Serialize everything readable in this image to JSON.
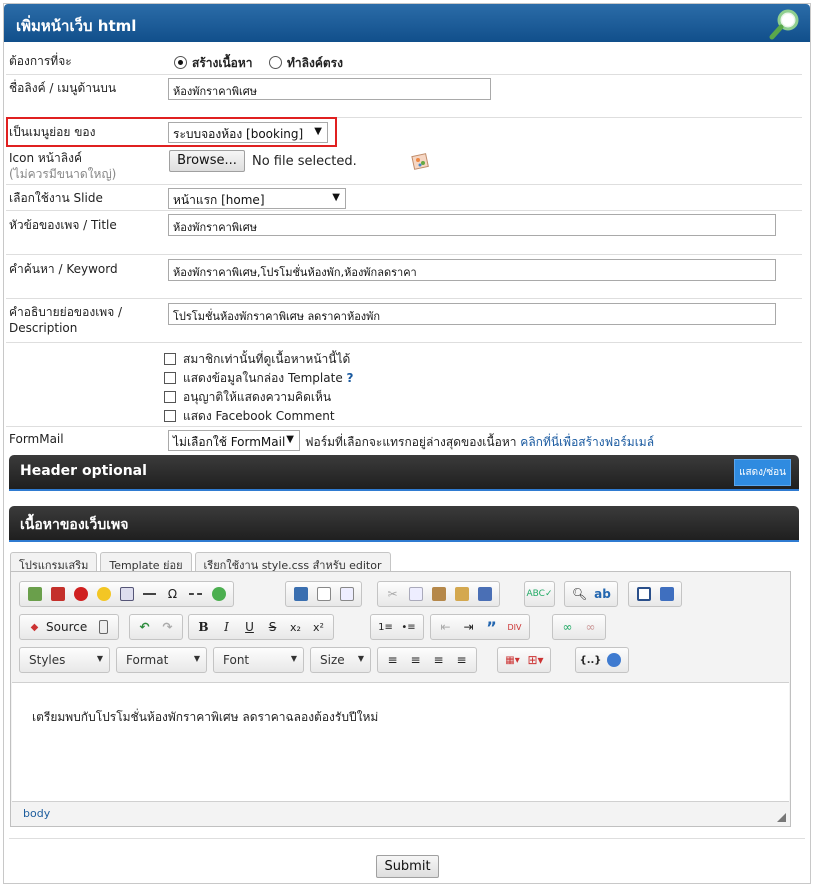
{
  "header": {
    "title": "เพิ่มหน้าเว็บ html",
    "icon": "magnifier-icon"
  },
  "form": {
    "want": {
      "label": "ต้องการที่จะ",
      "options": [
        "สร้างเนื้อหา",
        "ทำลิงค์ตรง"
      ],
      "selected": "สร้างเนื้อหา"
    },
    "linkname": {
      "label": "ชื่อลิงค์ / เมนูด้านบน",
      "value": "ห้องพักราคาพิเศษ"
    },
    "submenu": {
      "label": "เป็นเมนูย่อย ของ",
      "value": "ระบบจองห้อง [booking]"
    },
    "icon": {
      "label": "Icon หน้าลิงค์",
      "hint": "(ไม่ควรมีขนาดใหญ่)",
      "browse": "Browse...",
      "status": "No file selected."
    },
    "slide": {
      "label": "เลือกใช้งาน Slide",
      "value": "หน้าแรก [home]"
    },
    "title": {
      "label": "หัวข้อของเพจ / Title",
      "value": "ห้องพักราคาพิเศษ"
    },
    "keyword": {
      "label": "คำค้นหา / Keyword",
      "value": "ห้องพักราคาพิเศษ,โปรโมชั่นห้องพัก,ห้องพักลดราคา"
    },
    "description": {
      "label": "คำอธิบายย่อของเพจ /",
      "label2": "Description",
      "value": "โปรโมชั่นห้องพักราคาพิเศษ ลดราคาห้องพัก"
    },
    "checkboxes": [
      "สมาชิกเท่านั้นที่ดูเนื้อหาหน้านี้ได้",
      "แสดงข้อมูลในกล่อง Template",
      "อนุญาติให้แสดงความคิดเห็น",
      "แสดง Facebook Comment"
    ],
    "template_help": "?",
    "formmail": {
      "label": "FormMail",
      "value": "ไม่เลือกใช้ FormMail",
      "note": "ฟอร์มที่เลือกจะแทรกอยู่ล่างสุดของเนื้อหา",
      "link": "คลิกที่นี่เพื่อสร้างฟอร์มเมล์"
    }
  },
  "header_optional": {
    "title": "Header optional",
    "toggle": "แสดง/ซ่อน"
  },
  "content_section": {
    "title": "เนื้อหาของเว็บเพจ"
  },
  "tabs": [
    "โปรแกรมเสริม",
    "Template ย่อย",
    "เรียกใช้งาน style.css สำหรับ editor"
  ],
  "editor": {
    "source_label": "Source",
    "combos": [
      "Styles",
      "Format",
      "Font",
      "Size"
    ],
    "body_text": "เตรียมพบกับโปรโมชั่นห้องพักราคาพิเศษ ลดราคาฉลองต้องรับปีใหม่",
    "path": "body"
  },
  "submit": "Submit"
}
